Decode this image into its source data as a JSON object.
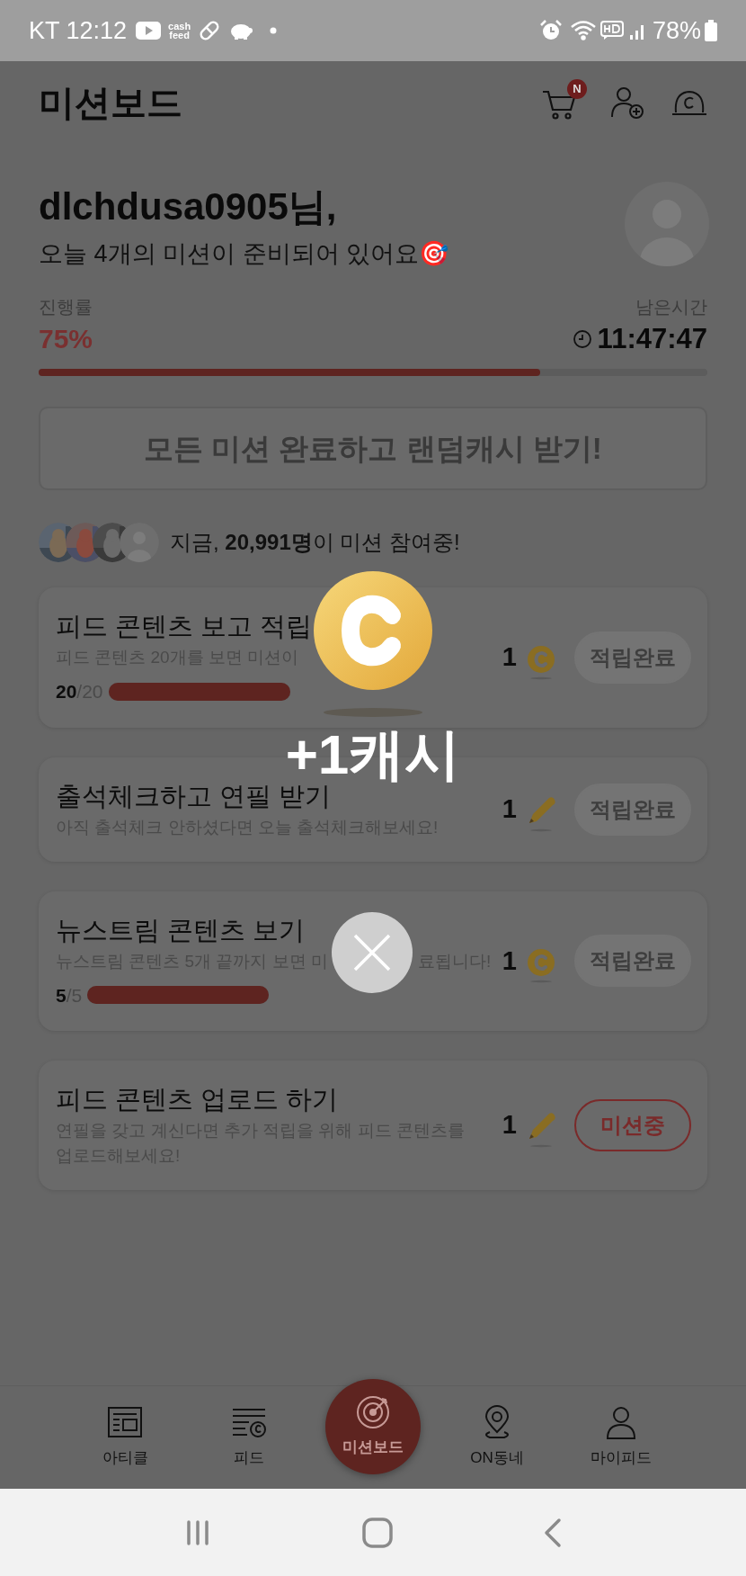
{
  "status_bar": {
    "carrier_time": "KT 12:12",
    "app_badge": "cash feed",
    "battery": "78%"
  },
  "header": {
    "title": "미션보드",
    "cart_badge": "N"
  },
  "user": {
    "greeting": "dlchdusa0905님,",
    "message": "오늘 4개의 미션이 준비되어 있어요🎯"
  },
  "progress": {
    "label": "진행률",
    "value": "75%",
    "level": 0.75,
    "time_label": "남은시간",
    "time": "11:47:47"
  },
  "complete_button": {
    "label": "모든 미션 완료하고 랜덤캐시 받기!",
    "disabled": true
  },
  "participants": {
    "avatars": [
      {
        "kind": "picture"
      },
      {
        "kind": "picture"
      },
      {
        "kind": "picture"
      },
      {
        "kind": "default"
      }
    ],
    "text": "지금, **20,991명**이 미션 참여중!"
  },
  "missions": [
    {
      "title": "피드 콘텐츠 보고 적립",
      "description": [
        "피드 콘텐츠 20개를 보면 미션이"
      ],
      "progress": {
        "current": "20",
        "total": "/20",
        "level": 1
      },
      "reward": {
        "amount": "1",
        "kind": "coin"
      },
      "button": {
        "label": "적립완료",
        "kind": "done"
      }
    },
    {
      "title": "출석체크하고 연필 받기",
      "description": [
        "아직 출석체크 안하셨다면 오늘 출석체크해보세요!"
      ],
      "reward": {
        "amount": "1",
        "kind": "pencil"
      },
      "button": {
        "label": "적립완료",
        "kind": "done"
      }
    },
    {
      "title": "뉴스트림 콘텐츠 보기",
      "description": [
        "뉴스트림 콘텐츠 5개 끝까지 보면 미",
        "료됩니다!"
      ],
      "progress": {
        "current": "5",
        "total": "/5",
        "level": 1
      },
      "reward": {
        "amount": "1",
        "kind": "coin"
      },
      "button": {
        "label": "적립완료",
        "kind": "done"
      }
    },
    {
      "title": "피드 콘텐츠 업로드 하기",
      "description": [
        "연필을 갖고 계신다면 추가 적립을 위해 피드 콘텐츠를 업로드해보세요!"
      ],
      "reward": {
        "amount": "1",
        "kind": "pencil"
      },
      "button": {
        "label": "미션중",
        "kind": "active"
      }
    }
  ],
  "reward_popup": {
    "amount": "+1캐시"
  },
  "bottom_nav": [
    {
      "label": "아티클",
      "selected": false
    },
    {
      "label": "피드",
      "selected": false
    },
    {
      "label": "미션보드",
      "selected": true
    },
    {
      "label": "ON동네",
      "selected": false
    },
    {
      "label": "마이피드",
      "selected": false
    }
  ]
}
